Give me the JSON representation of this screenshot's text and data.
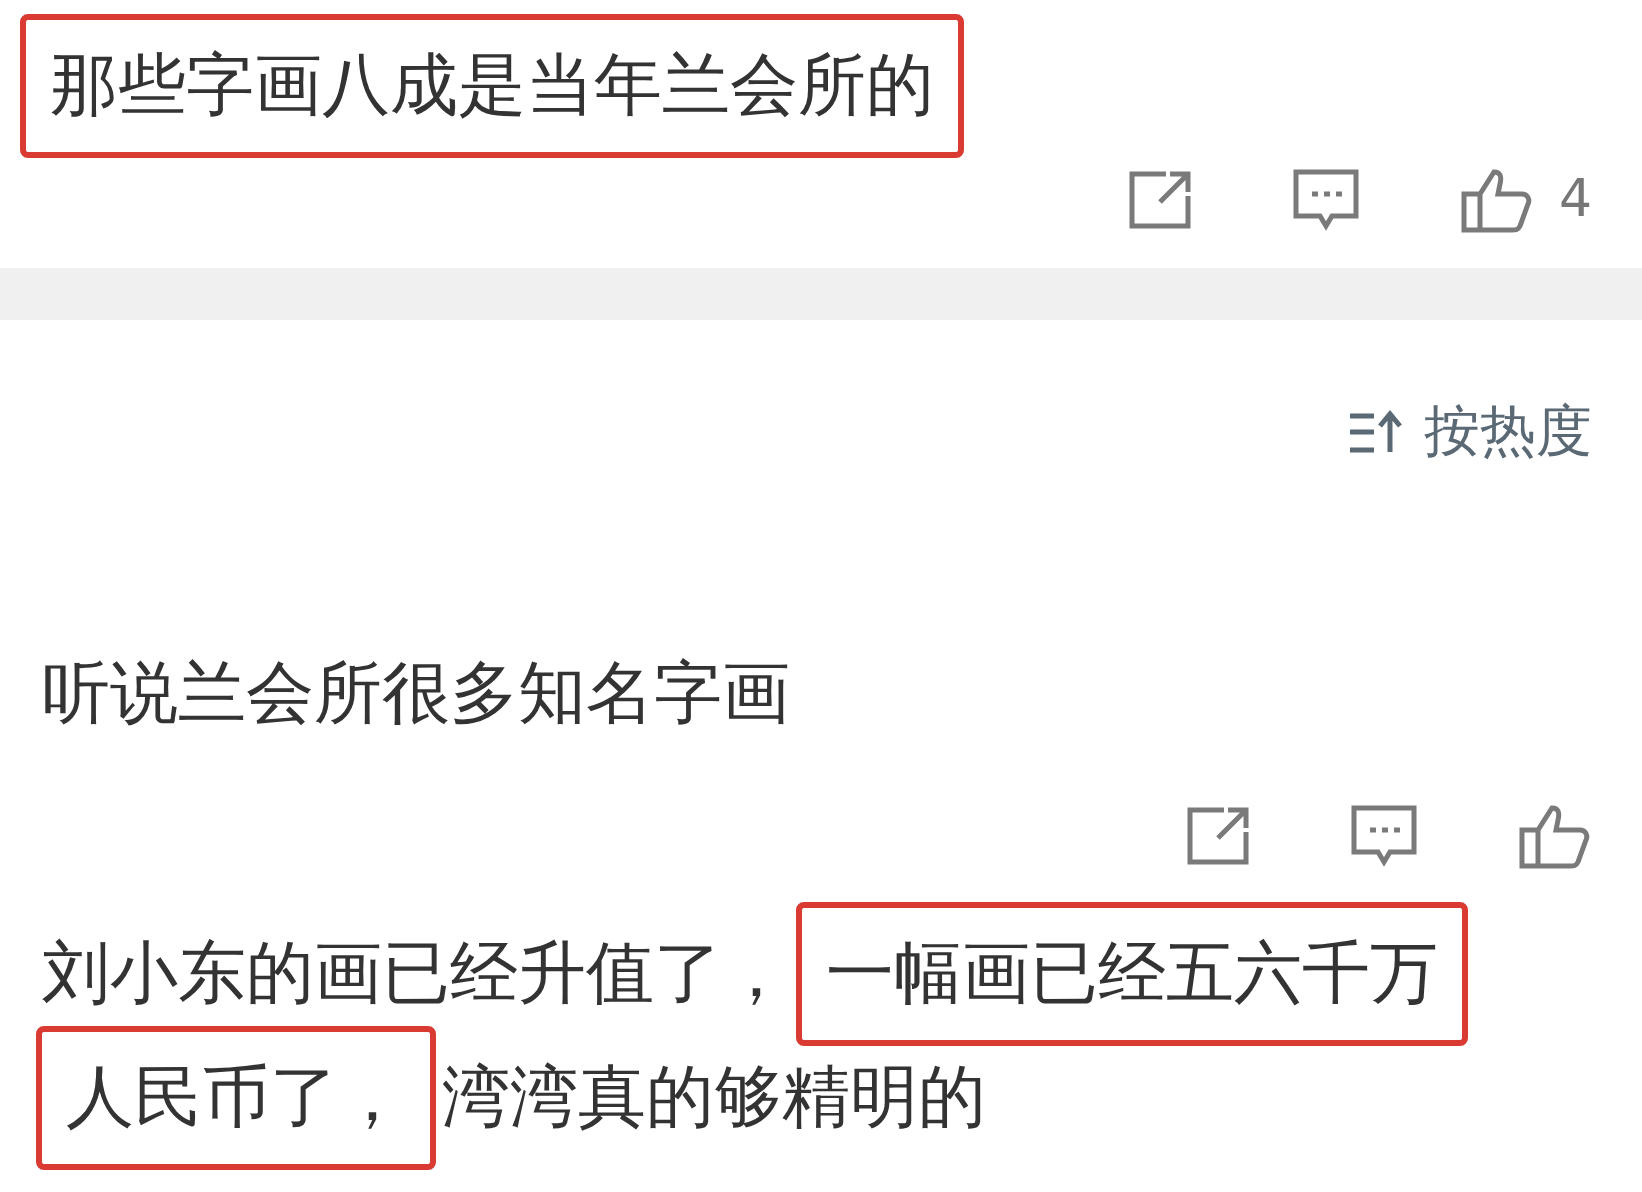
{
  "comments": [
    {
      "lines": [
        [
          {
            "text": "那些字画八成是当年兰会所的",
            "highlighted": true
          }
        ]
      ],
      "actions": true,
      "likes": "4"
    },
    {
      "sort": {
        "label": "按热度"
      }
    },
    {
      "lines": [
        [
          {
            "text": "听说兰会所很多知名字画",
            "highlighted": false
          }
        ]
      ],
      "actions": true
    },
    {
      "lines": [
        [
          {
            "text": "刘小东的画已经升值了，",
            "highlighted": false
          },
          {
            "text": "一幅画已经五六千万",
            "highlighted": true
          }
        ],
        [
          {
            "text": "人民币了，",
            "highlighted": true
          },
          {
            "text": "湾湾真的够精明的",
            "highlighted": false
          }
        ]
      ],
      "actions": false
    }
  ]
}
